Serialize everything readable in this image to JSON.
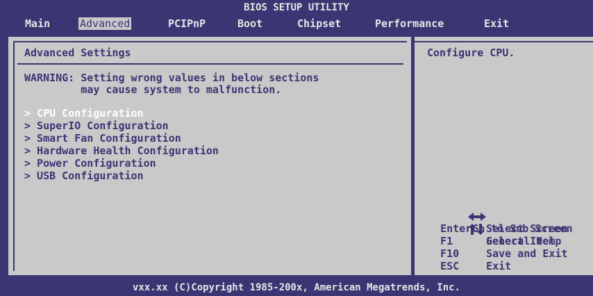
{
  "title": "BIOS SETUP UTILITY",
  "menu": [
    {
      "label": "Main",
      "name": "menu-main"
    },
    {
      "label": "Advanced",
      "name": "menu-advanced"
    },
    {
      "label": "PCIPnP",
      "name": "menu-pcipnp"
    },
    {
      "label": "Boot",
      "name": "menu-boot"
    },
    {
      "label": "Chipset",
      "name": "menu-chipset"
    },
    {
      "label": "Performance",
      "name": "menu-performance"
    },
    {
      "label": "Exit",
      "name": "menu-exit"
    }
  ],
  "active_menu": "Advanced",
  "main": {
    "heading": "Advanced Settings",
    "warning_line1": "WARNING: Setting wrong values in below sections",
    "warning_line2": "         may cause system to malfunction.",
    "items": [
      {
        "label": "> CPU Configuration",
        "selected": true
      },
      {
        "label": "> SuperIO Configuration",
        "selected": false
      },
      {
        "label": "> Smart Fan Configuration",
        "selected": false
      },
      {
        "label": "> Hardware Health Configuration",
        "selected": false
      },
      {
        "label": "> Power Configuration",
        "selected": false
      },
      {
        "label": "> USB Configuration",
        "selected": false
      }
    ]
  },
  "help": {
    "text": "Configure CPU.",
    "keys": [
      {
        "key": "",
        "icon": "left-right-arrows-icon",
        "desc": "Select Screen"
      },
      {
        "key": "",
        "icon": "up-down-arrows-icon",
        "desc": "Select Item"
      },
      {
        "key": "Enter",
        "icon": "",
        "desc": "Go to Sub Screen"
      },
      {
        "key": "F1",
        "icon": "",
        "desc": "General Help"
      },
      {
        "key": "F10",
        "icon": "",
        "desc": "Save and Exit"
      },
      {
        "key": "ESC",
        "icon": "",
        "desc": "Exit"
      }
    ]
  },
  "footer": "vxx.xx (C)Copyright 1985-200x, American Megatrends, Inc.",
  "colors": {
    "background": "#3b3573",
    "panel": "#c9c9c9",
    "selected_text": "#ffffff",
    "header_text": "#e6e6e6"
  }
}
